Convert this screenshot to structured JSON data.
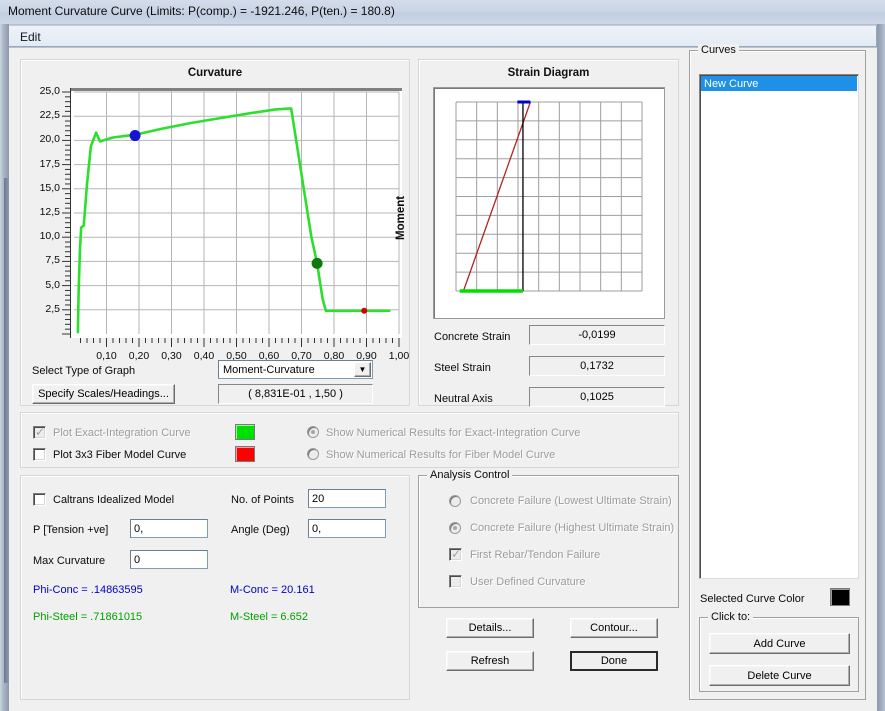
{
  "window": {
    "title": "Moment Curvature Curve (Limits:  P(comp.) = -1921.246, P(ten.) = 180.8)",
    "menu_edit": "Edit"
  },
  "curvature_panel": {
    "title": "Curvature",
    "y_axis_label": "Moment",
    "select_type_label": "Select Type of Graph",
    "graph_type_value": "Moment-Curvature",
    "specify_scales_button": "Specify Scales/Headings...",
    "coord_readout": "( 8,831E-01 , 1,50 )"
  },
  "strain_panel": {
    "title": "Strain Diagram",
    "rows": [
      {
        "label": "Concrete Strain",
        "value": "-0,0199"
      },
      {
        "label": "Steel Strain",
        "value": "0,1732"
      },
      {
        "label": "Neutral Axis",
        "value": "0,1025"
      }
    ]
  },
  "plot_options": {
    "exact_integration_label": "Plot Exact-Integration Curve",
    "exact_integration_checked": true,
    "exact_integration_color": "#00E000",
    "fiber_model_label": "Plot 3x3 Fiber Model Curve",
    "fiber_model_checked": false,
    "fiber_model_color": "#FF0000",
    "show_numerical_exact_label": "Show Numerical Results for Exact-Integration Curve",
    "show_numerical_fiber_label": "Show Numerical Results for Fiber Model Curve"
  },
  "inputs": {
    "caltrans_label": "Caltrans Idealized Model",
    "p_tension_label": "P [Tension +ve]",
    "p_tension_value": "0,",
    "max_curvature_label": "Max Curvature",
    "max_curvature_value": "0",
    "no_points_label": "No. of Points",
    "no_points_value": "20",
    "angle_label": "Angle (Deg)",
    "angle_value": "0,",
    "results": [
      {
        "text": "Phi-Conc = .14863595",
        "color": "#0000C8"
      },
      {
        "text": "M-Conc = 20.161",
        "color": "#0000C8"
      },
      {
        "text": "Phi-Steel = .71861015",
        "color": "#00A000"
      },
      {
        "text": "M-Steel = 6.652",
        "color": "#00A000"
      }
    ]
  },
  "analysis_control": {
    "legend": "Analysis Control",
    "options": [
      {
        "label": "Concrete Failure (Lowest Ultimate Strain)",
        "type": "radio",
        "selected": false
      },
      {
        "label": "Concrete Failure (Highest Ultimate Strain)",
        "type": "radio",
        "selected": true
      },
      {
        "label": "First Rebar/Tendon Failure",
        "type": "checkbox",
        "selected": true
      },
      {
        "label": "User Defined Curvature",
        "type": "checkbox",
        "selected": false
      }
    ]
  },
  "action_buttons": {
    "details": "Details...",
    "contour": "Contour...",
    "refresh": "Refresh",
    "done": "Done"
  },
  "curves_panel": {
    "legend": "Curves",
    "items": [
      "New Curve"
    ],
    "selected_curve_color_label": "Selected Curve Color",
    "selected_curve_color": "#000000",
    "click_to_legend": "Click to:",
    "add_curve": "Add Curve",
    "delete_curve": "Delete Curve"
  },
  "chart_data": {
    "type": "line",
    "title": "Curvature",
    "xlabel": "",
    "ylabel": "Moment",
    "xlim": [
      0.0,
      1.0
    ],
    "ylim": [
      0.0,
      25.0
    ],
    "xticks": [
      0.1,
      0.2,
      0.3,
      0.4,
      0.5,
      0.6,
      0.7,
      0.8,
      0.9,
      1.0
    ],
    "xticklabels": [
      "0,10",
      "0,20",
      "0,30",
      "0,40",
      "0,50",
      "0,60",
      "0,70",
      "0,80",
      "0,90",
      "1,00"
    ],
    "yticks": [
      2.5,
      5.0,
      7.5,
      10.0,
      12.5,
      15.0,
      17.5,
      20.0,
      22.5,
      25.0
    ],
    "yticklabels": [
      "2,5",
      "5,0",
      "7,5",
      "10,0",
      "12,5",
      "15,0",
      "17,5",
      "20,0",
      "22,5",
      "25,0"
    ],
    "grid": true,
    "legend_position": "none",
    "series": [
      {
        "name": "Exact-Integration Curve",
        "color": "#2BE02B",
        "x": [
          0.012,
          0.014,
          0.018,
          0.022,
          0.03,
          0.04,
          0.052,
          0.068,
          0.08,
          0.12,
          0.19,
          0.27,
          0.36,
          0.45,
          0.54,
          0.62,
          0.668,
          0.672,
          0.7,
          0.73,
          0.748,
          0.765,
          0.775,
          0.86,
          0.97
        ],
        "y": [
          0.2,
          4.0,
          8.5,
          11.0,
          11.2,
          15.5,
          19.4,
          20.8,
          19.9,
          20.3,
          20.6,
          21.2,
          21.8,
          22.3,
          22.8,
          23.2,
          23.3,
          22.5,
          16.5,
          10.1,
          7.3,
          3.6,
          2.4,
          2.4,
          2.4
        ]
      }
    ],
    "markers": [
      {
        "name": "concrete-failure-point",
        "x": 0.188,
        "y": 20.5,
        "color": "#1414D2",
        "r": 5.5
      },
      {
        "name": "steel-failure-point",
        "x": 0.748,
        "y": 7.3,
        "color": "#0C7A0C",
        "r": 5.5
      },
      {
        "name": "end-point",
        "x": 0.893,
        "y": 2.4,
        "color": "#D00000",
        "r": 3.0
      }
    ]
  },
  "strain_diagram_data": {
    "type": "line",
    "grid_cols": 9,
    "grid_rows": 10,
    "series": [
      {
        "name": "strain-profile",
        "color": "#B22222",
        "x": [
          0.04,
          0.4
        ],
        "y": [
          0.0,
          1.0
        ]
      },
      {
        "name": "section-depth-line",
        "color": "#000000",
        "x": [
          0.36,
          0.36
        ],
        "y": [
          0.0,
          1.0
        ]
      },
      {
        "name": "compression-block",
        "color": "#00E000",
        "x": [
          0.02,
          0.36
        ],
        "y": [
          0.0,
          0.0
        ]
      },
      {
        "name": "top-fiber-marker",
        "color": "#0000CC",
        "x": [
          0.33,
          0.4
        ],
        "y": [
          1.0,
          1.0
        ]
      }
    ]
  }
}
